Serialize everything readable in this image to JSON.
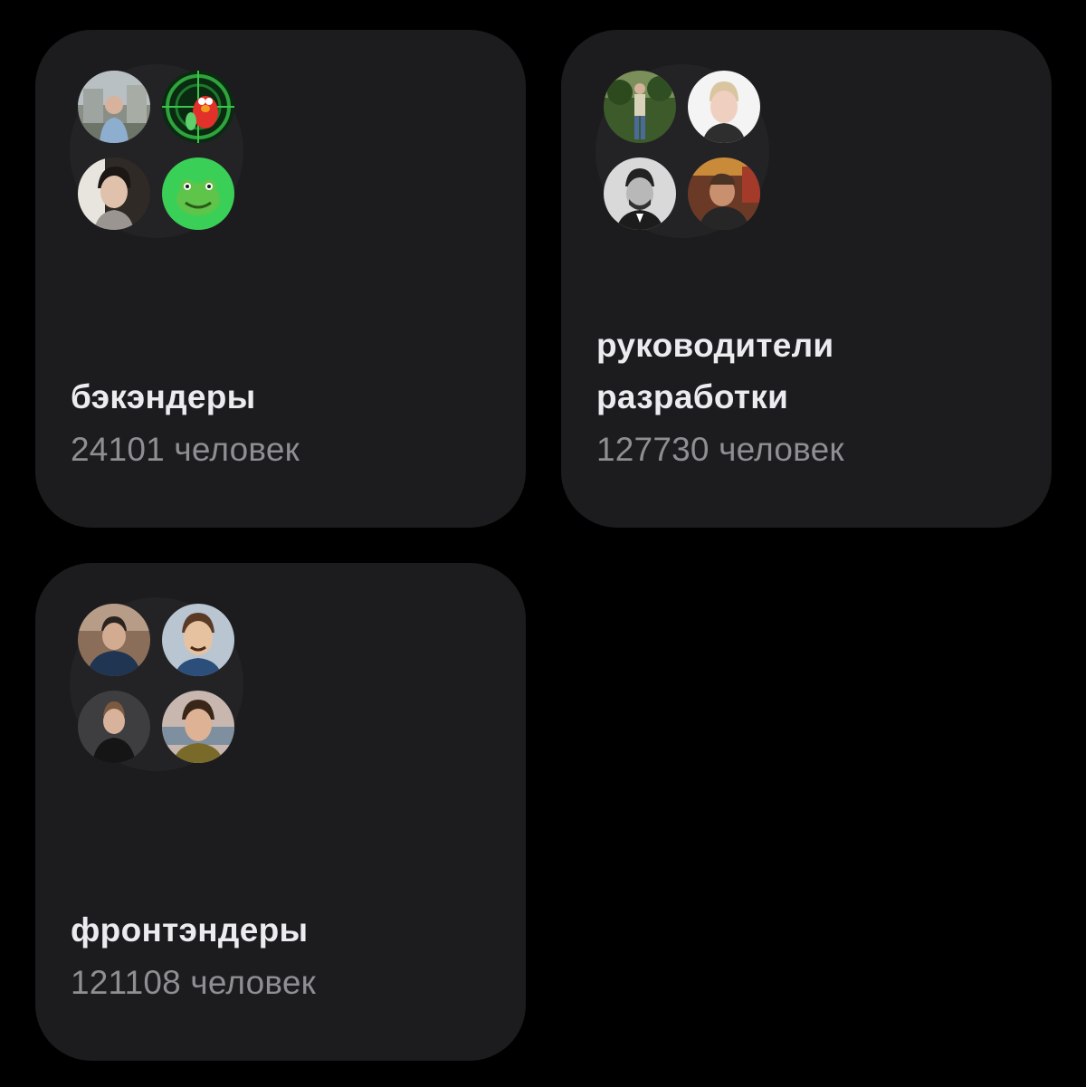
{
  "groups": [
    {
      "title": "бэкэндеры",
      "count": "24101 человек",
      "avatars": [
        "person-photo",
        "elmo-photo",
        "person-photo",
        "frog-emoji-avatar"
      ]
    },
    {
      "title": "руководители разработки",
      "count": "127730 человек",
      "avatars": [
        "person-photo",
        "person-photo",
        "person-photo",
        "person-photo"
      ]
    },
    {
      "title": "фронтэндеры",
      "count": "121108 человек",
      "avatars": [
        "person-photo",
        "person-photo",
        "person-photo",
        "person-photo"
      ]
    }
  ]
}
